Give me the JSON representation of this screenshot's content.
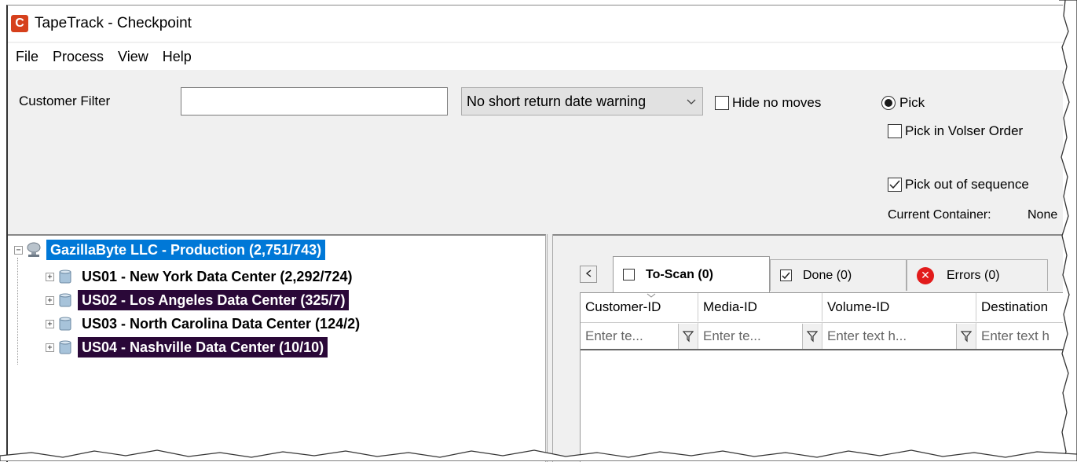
{
  "window": {
    "title": "TapeTrack - Checkpoint",
    "icon_letter": "C"
  },
  "menu": [
    "File",
    "Process",
    "View",
    "Help"
  ],
  "toolbar": {
    "customer_filter_label": "Customer Filter",
    "customer_filter_value": "",
    "warning_select": "No short return date warning",
    "hide_no_moves": {
      "label": "Hide no moves",
      "checked": false
    },
    "pick": {
      "label": "Pick",
      "selected": true
    },
    "pick_volser_order": {
      "label": "Pick in Volser Order",
      "checked": false
    },
    "pick_out_of_sequence": {
      "label": "Pick out of sequence",
      "checked": true
    },
    "current_container_label": "Current Container:",
    "current_container_value": "None"
  },
  "tree": {
    "root": {
      "label": "GazillaByte LLC - Production (2,751/743)"
    },
    "children": [
      {
        "label": "US01 - New York Data Center (2,292/724)"
      },
      {
        "label": "US02 - Los Angeles Data Center (325/7)"
      },
      {
        "label": "US03 - North Carolina Data Center (124/2)"
      },
      {
        "label": "US04 - Nashville Data Center (10/10)"
      }
    ]
  },
  "tabs": [
    {
      "label": "To-Scan (0)",
      "checked": false
    },
    {
      "label": "Done (0)",
      "checked": true
    },
    {
      "label": "Errors (0)"
    }
  ],
  "grid": {
    "columns": [
      "Customer-ID",
      "Media-ID",
      "Volume-ID",
      "Destination"
    ],
    "filter_placeholders": [
      "Enter te...",
      "Enter te...",
      "Enter text h...",
      "Enter text h"
    ]
  },
  "colors": {
    "selection": "#0078d7",
    "dark_highlight": "#2a0838",
    "error": "#e21b1b",
    "app_icon": "#d6401c"
  }
}
